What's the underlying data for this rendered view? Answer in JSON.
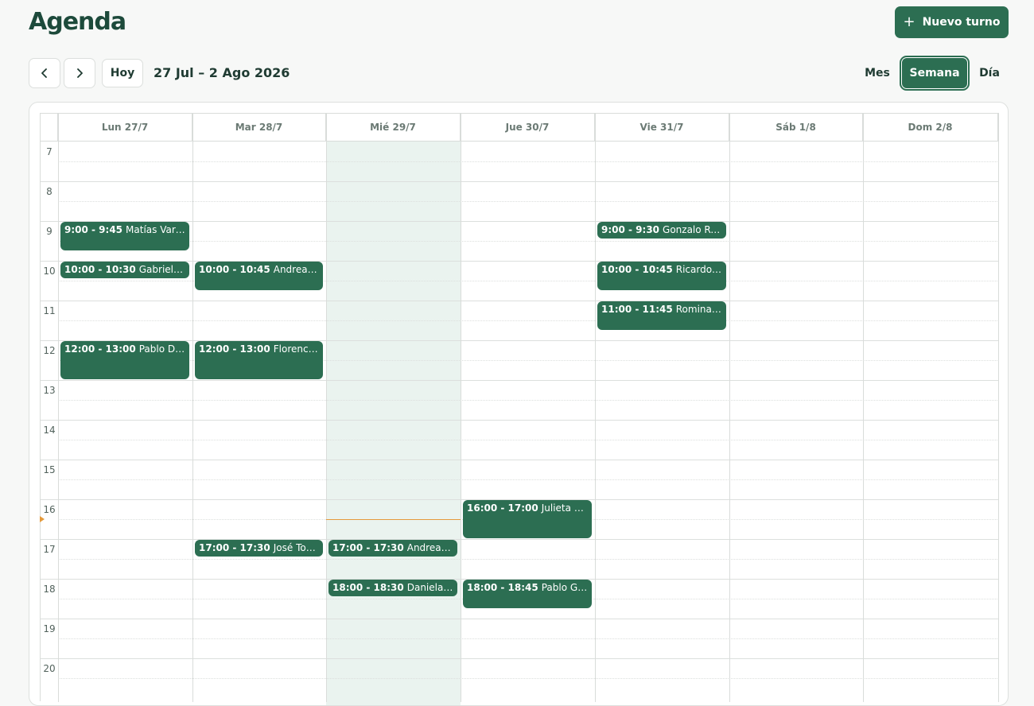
{
  "header": {
    "title": "Agenda",
    "new_button_label": "Nuevo turno",
    "new_button_icon": "plus-icon"
  },
  "toolbar": {
    "prev_icon": "chevron-left-icon",
    "next_icon": "chevron-right-icon",
    "today_label": "Hoy",
    "range_label": "27 Jul – 2 Ago 2026",
    "views": [
      {
        "label": "Mes",
        "active": false
      },
      {
        "label": "Semana",
        "active": true
      },
      {
        "label": "Día",
        "active": false
      }
    ]
  },
  "calendar": {
    "days": [
      "Lun 27/7",
      "Mar 28/7",
      "Mié 29/7",
      "Jue 30/7",
      "Vie 31/7",
      "Sáb 1/8",
      "Dom 2/8"
    ],
    "today_index": 2,
    "hours": [
      "7",
      "8",
      "9",
      "10",
      "11",
      "12",
      "13",
      "14",
      "15",
      "16",
      "17",
      "18",
      "19",
      "20"
    ],
    "now_time": 16.5,
    "events": [
      {
        "day": 0,
        "start": 9,
        "end": 9.75,
        "time": "9:00 - 9:45",
        "name": "Matías Vargas"
      },
      {
        "day": 0,
        "start": 10,
        "end": 10.5,
        "time": "10:00 - 10:30",
        "name": "Gabriel Jiménez"
      },
      {
        "day": 0,
        "start": 12,
        "end": 13,
        "time": "12:00 - 13:00",
        "name": "Pablo Díaz"
      },
      {
        "day": 1,
        "start": 10,
        "end": 10.75,
        "time": "10:00 - 10:45",
        "name": "Andrea Ruiz"
      },
      {
        "day": 1,
        "start": 12,
        "end": 13,
        "time": "12:00 - 13:00",
        "name": "Florencia Martínez"
      },
      {
        "day": 1,
        "start": 17,
        "end": 17.5,
        "time": "17:00 - 17:30",
        "name": "José Torres"
      },
      {
        "day": 2,
        "start": 17,
        "end": 17.5,
        "time": "17:00 - 17:30",
        "name": "Andrea Morales"
      },
      {
        "day": 2,
        "start": 18,
        "end": 18.5,
        "time": "18:00 - 18:30",
        "name": "Daniela Ramírez"
      },
      {
        "day": 3,
        "start": 16,
        "end": 17,
        "time": "16:00 - 17:00",
        "name": "Julieta López"
      },
      {
        "day": 3,
        "start": 18,
        "end": 18.75,
        "time": "18:00 - 18:45",
        "name": "Pablo González"
      },
      {
        "day": 4,
        "start": 9,
        "end": 9.5,
        "time": "9:00 - 9:30",
        "name": "Gonzalo Romero"
      },
      {
        "day": 4,
        "start": 10,
        "end": 10.75,
        "time": "10:00 - 10:45",
        "name": "Ricardo Jiménez"
      },
      {
        "day": 4,
        "start": 11,
        "end": 11.75,
        "time": "11:00 - 11:45",
        "name": "Romina García"
      }
    ]
  },
  "colors": {
    "primary": "#2c6e52",
    "today_column": "#eaf3ef",
    "now_indicator": "#e59a3c"
  }
}
